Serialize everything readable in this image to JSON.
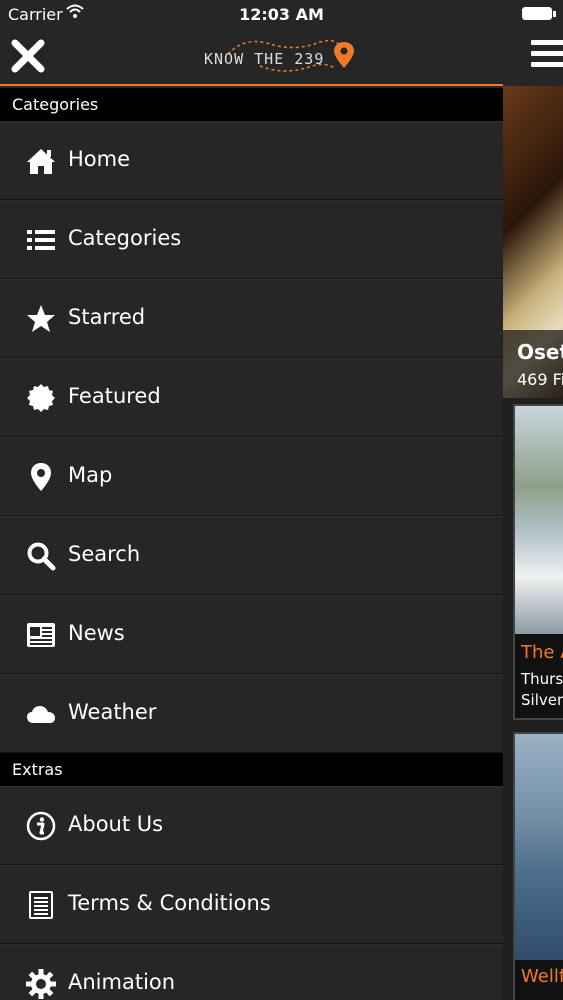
{
  "status_bar": {
    "carrier": "Carrier",
    "time": "12:03 AM"
  },
  "header": {
    "logo_text": "KNOW THE 239",
    "accent_color": "#f07a2a"
  },
  "sections": {
    "categories": "Categories",
    "extras": "Extras"
  },
  "menu": {
    "main": [
      {
        "label": "Home",
        "icon": "home-icon"
      },
      {
        "label": "Categories",
        "icon": "list-icon"
      },
      {
        "label": "Starred",
        "icon": "star-icon"
      },
      {
        "label": "Featured",
        "icon": "badge-icon"
      },
      {
        "label": "Map",
        "icon": "map-pin-icon"
      },
      {
        "label": "Search",
        "icon": "search-icon"
      },
      {
        "label": "News",
        "icon": "newspaper-icon"
      },
      {
        "label": "Weather",
        "icon": "cloud-icon"
      }
    ],
    "extras": [
      {
        "label": "About Us",
        "icon": "info-icon"
      },
      {
        "label": "Terms & Conditions",
        "icon": "document-icon"
      },
      {
        "label": "Animation",
        "icon": "gear-icon"
      }
    ]
  },
  "background": {
    "feature_title": "Oset",
    "feature_sub": "469 Fi",
    "card1_title": "The A",
    "card1_line1": "Thursd",
    "card1_line2": "Silvers",
    "card2_title": "Wellf"
  }
}
